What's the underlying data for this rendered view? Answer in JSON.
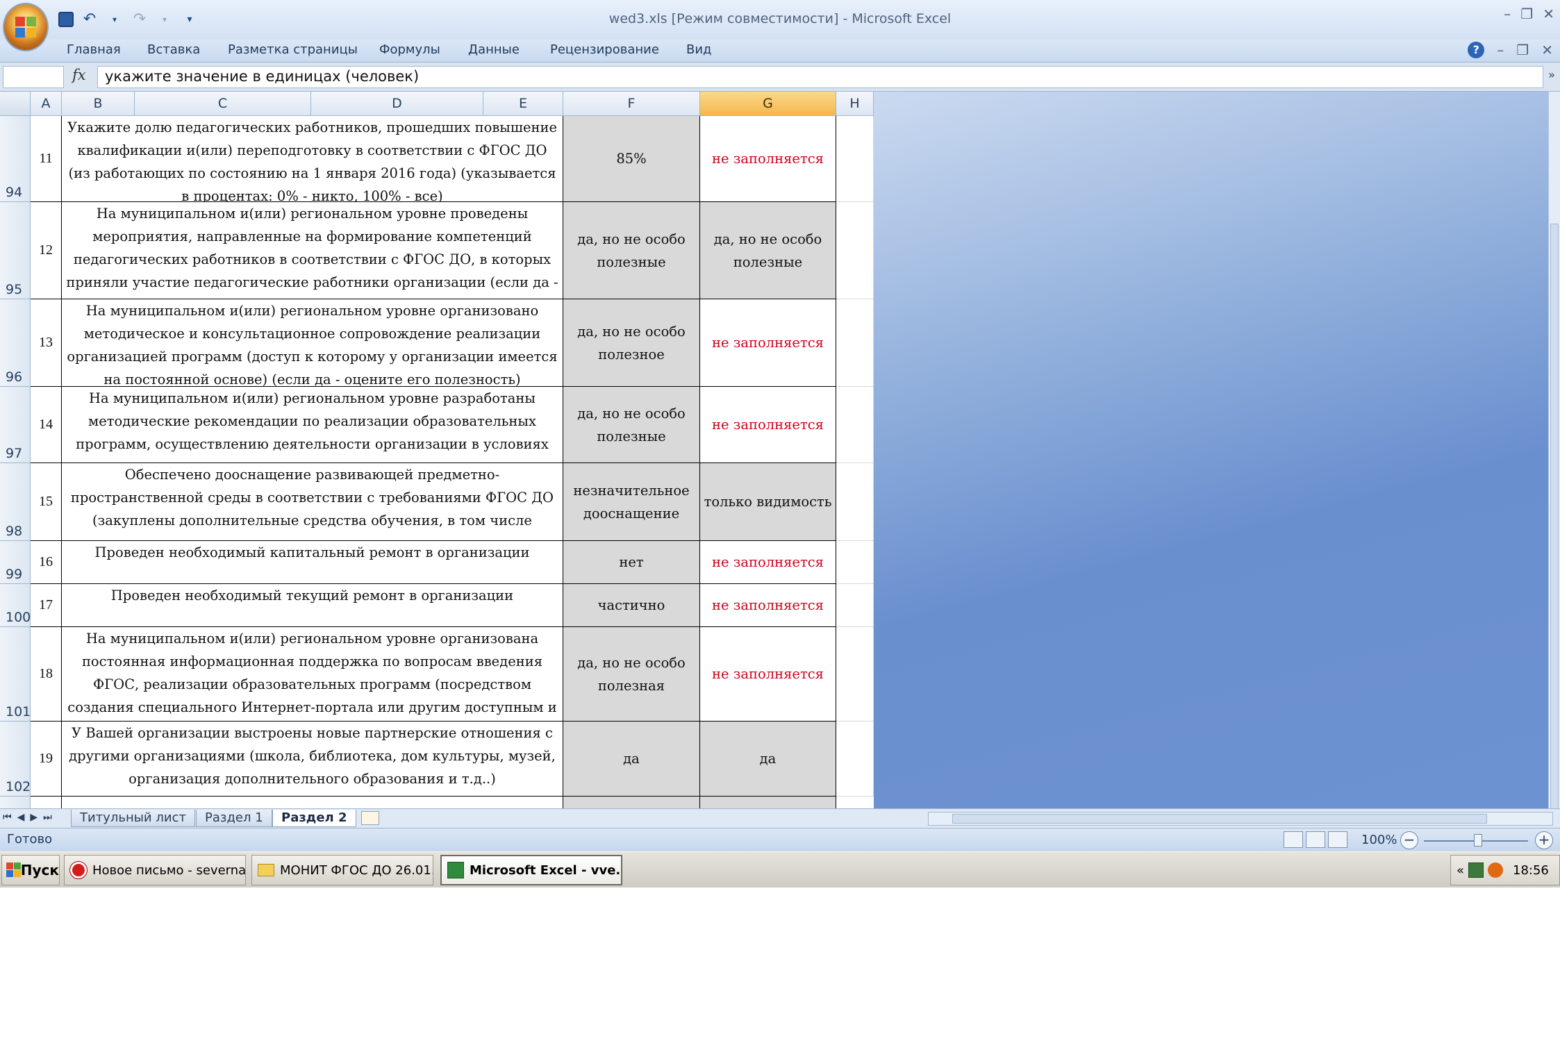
{
  "window": {
    "title": "wed3.xls  [Режим совместимости] - Microsoft Excel"
  },
  "ribbon": {
    "tabs": [
      "Главная",
      "Вставка",
      "Разметка страницы",
      "Формулы",
      "Данные",
      "Рецензирование",
      "Вид"
    ]
  },
  "formula_bar": {
    "name_box": "",
    "fx_label": "fx",
    "value": "укажите значение в единицах (человек)"
  },
  "columns": [
    "A",
    "B",
    "C",
    "D",
    "E",
    "F",
    "G",
    "H"
  ],
  "selected_column": "G",
  "rows": [
    {
      "row": "94",
      "num": "11",
      "question": "Укажите долю педагогических работников, прошедших повышение квалификации и(или) переподготовку в соответствии с ФГОС ДО (из работающих по состоянию на 1 января 2016 года) (указывается в процентах: 0% - никто, 100% - все)",
      "f": "85%",
      "g": "не заполняется",
      "g_style": "red"
    },
    {
      "row": "95",
      "num": "12",
      "question": "На муниципальном и(или) региональном уровне проведены мероприятия, направленные на формирование компетенций педагогических работников в соответствии с ФГОС ДО, в которых приняли участие педагогические работники организации (если да -",
      "f": "да, но не особо полезные",
      "g": "да, но не особо полезные",
      "g_style": "gray"
    },
    {
      "row": "96",
      "num": "13",
      "question": "На муниципальном и(или) региональном уровне организовано методическое и консультационное сопровождение реализации организацией программ (доступ к которому у организации имеется на постоянной основе) (если да - оцените его полезность)",
      "f": "да, но не особо полезное",
      "g": "не заполняется",
      "g_style": "red"
    },
    {
      "row": "97",
      "num": "14",
      "question": "На муниципальном и(или) региональном уровне разработаны методические рекомендации по реализации образовательных программ, осуществлению деятельности организации в условиях",
      "f": "да, но не особо полезные",
      "g": "не заполняется",
      "g_style": "red"
    },
    {
      "row": "98",
      "num": "15",
      "question": "Обеспечено дооснащение развивающей предметно-пространственной среды в соответствии с требованиями ФГОС ДО (закуплены дополнительные средства обучения, в том числе",
      "f": "незначительное дооснащение",
      "g": "только видимость",
      "g_style": "gray"
    },
    {
      "row": "99",
      "num": "16",
      "question": "Проведен необходимый капитальный ремонт в организации",
      "f": "нет",
      "g": "не заполняется",
      "g_style": "red"
    },
    {
      "row": "100",
      "num": "17",
      "question": "Проведен необходимый текущий ремонт в организации",
      "f": "частично",
      "g": "не заполняется",
      "g_style": "red"
    },
    {
      "row": "101",
      "num": "18",
      "question": "На муниципальном и(или) региональном уровне организована постоянная информационная поддержка по вопросам введения ФГОС, реализации образовательных программ (посредством создания специального Интернет-портала или другим доступным и",
      "f": "да, но не особо полезная",
      "g": "не заполняется",
      "g_style": "red"
    },
    {
      "row": "102",
      "num": "19",
      "question": "У Вашей организации выстроены новые партнерские отношения с другими организациями (школа, библиотека, дом культуры, музей, организация дополнительного образования и т.д..)",
      "f": "да",
      "g": "да",
      "g_style": "gray"
    }
  ],
  "sheet_tabs": [
    {
      "label": "Титульный лист",
      "active": false
    },
    {
      "label": "Раздел 1",
      "active": false
    },
    {
      "label": "Раздел 2",
      "active": true
    }
  ],
  "status": {
    "text": "Готово",
    "zoom": "100%"
  },
  "taskbar": {
    "start": "Пуск",
    "buttons": [
      {
        "label": "Новое письмо - severna...",
        "icon": "opera-icon",
        "active": false
      },
      {
        "label": "МОНИТ ФГОС ДО 26.01....",
        "icon": "folder-icon",
        "active": false
      },
      {
        "label": "Microsoft Excel - vve...",
        "icon": "excel-icon",
        "active": true
      }
    ],
    "tray_chevron": "«",
    "clock": "18:56"
  },
  "colors": {
    "red_text": "#d0021b",
    "answer_gray": "#d9d9d9",
    "selected_header": "#f5b84c"
  }
}
